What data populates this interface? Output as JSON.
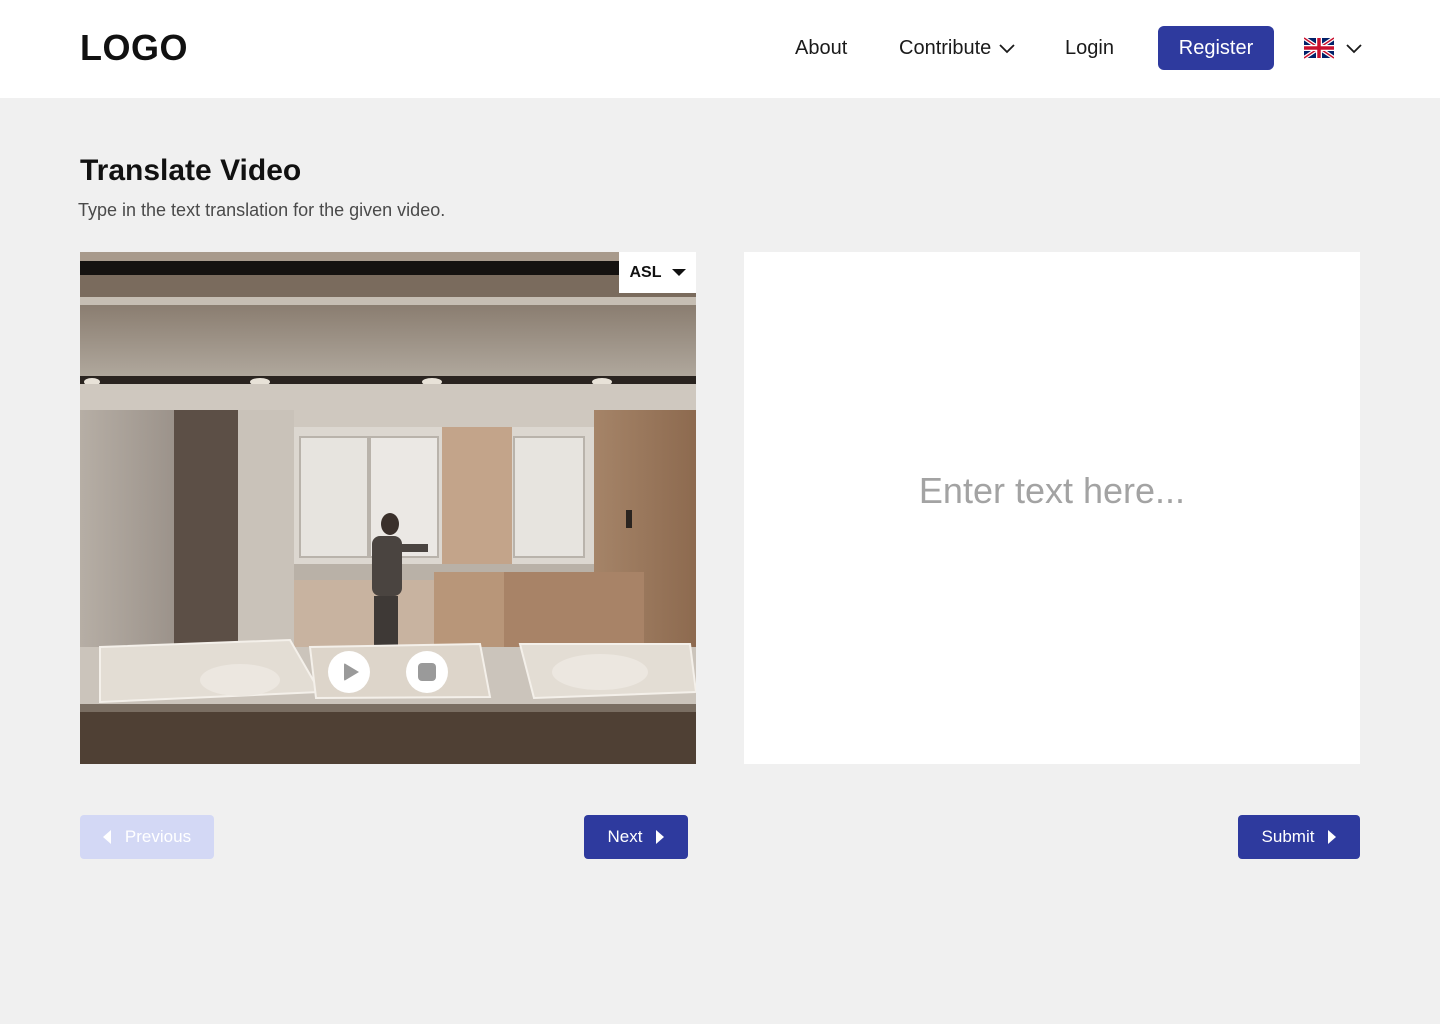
{
  "header": {
    "logo": "LOGO",
    "nav": {
      "about": "About",
      "contribute": "Contribute",
      "login": "Login"
    },
    "register_label": "Register",
    "language_icon": "uk-flag-icon"
  },
  "page": {
    "title": "Translate Video",
    "subtitle": "Type in the text translation for the given video."
  },
  "video": {
    "sign_language": "ASL",
    "controls": [
      "play-icon",
      "stop-icon"
    ]
  },
  "translation": {
    "placeholder": "Enter text here..."
  },
  "buttons": {
    "previous": "Previous",
    "next": "Next",
    "submit": "Submit"
  },
  "colors": {
    "primary": "#2e3a9e",
    "primary_disabled": "#d3d8f5",
    "background": "#f0f0f0"
  }
}
